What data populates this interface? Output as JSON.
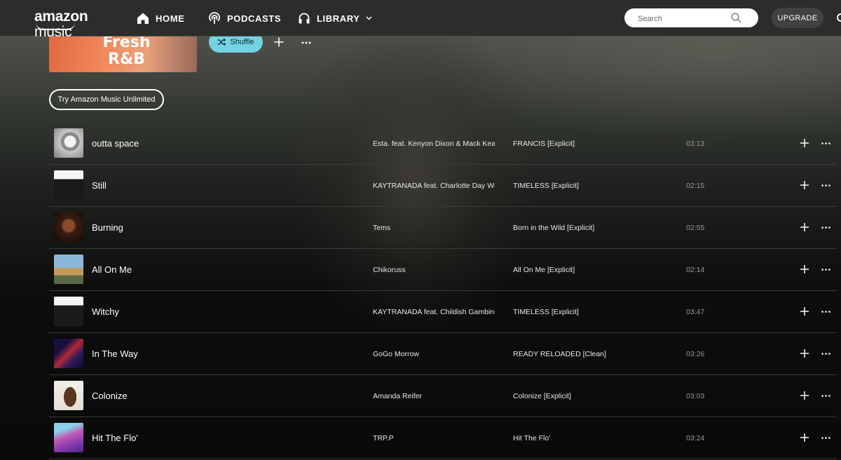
{
  "brand": {
    "logo_text_bold": "amazon",
    "logo_text_thin": "music"
  },
  "nav": {
    "home": "HOME",
    "podcasts": "PODCASTS",
    "library": "LIBRARY"
  },
  "search": {
    "placeholder": "Search"
  },
  "upgrade_label": "UPGRADE",
  "playlist": {
    "cover_line1": "Fresh",
    "cover_line2": "R&B",
    "shuffle_label": "Shuffle",
    "try_unlimited_label": "Try Amazon Music Unlimited"
  },
  "colors": {
    "accent": "#74d2e2",
    "topbar": "#2a2d29"
  },
  "tracks": [
    {
      "title": "outta space",
      "artist": "Esta. feat. Kenyon Dixon & Mack Keane",
      "album": "FRANCIS [Explicit]",
      "duration": "03:13",
      "art": "grey-astronaut"
    },
    {
      "title": "Still",
      "artist": "KAYTRANADA feat. Charlotte Day Wilson",
      "album": "TIMELESS [Explicit]",
      "duration": "02:15",
      "art": "timeless-bw"
    },
    {
      "title": "Burning",
      "artist": "Tems",
      "album": "Born in the Wild [Explicit]",
      "duration": "02:55",
      "art": "dark-portrait"
    },
    {
      "title": "All On Me",
      "artist": "Chikoruss",
      "album": "All On Me [Explicit]",
      "duration": "02:14",
      "art": "street-color"
    },
    {
      "title": "Witchy",
      "artist": "KAYTRANADA feat. Childish Gambino",
      "album": "TIMELESS [Explicit]",
      "duration": "03:47",
      "art": "timeless-bw"
    },
    {
      "title": "In The Way",
      "artist": "GoGo Morrow",
      "album": "READY RELOADED [Clean]",
      "duration": "03:26",
      "art": "neon-script"
    },
    {
      "title": "Colonize",
      "artist": "Amanda Reifer",
      "album": "Colonize [Explicit]",
      "duration": "03:03",
      "art": "white-portrait"
    },
    {
      "title": "Hit The Flo'",
      "artist": "TRP.P",
      "album": "Hit The Flo'",
      "duration": "03:24",
      "art": "purple-pink"
    }
  ]
}
